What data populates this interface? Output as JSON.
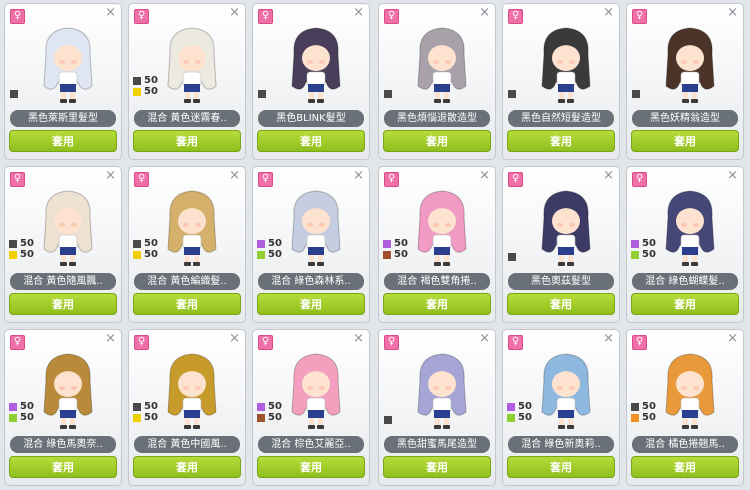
{
  "icons": {
    "gender": "♀",
    "close": "×"
  },
  "apply_label": "套用",
  "cards": [
    {
      "name": "黑色萊斯里髮型",
      "stats": [],
      "hair": "#dfe6f2",
      "marker": true
    },
    {
      "name": "混合 黃色迷霧春..",
      "stats": [
        {
          "color": "#4a4a4a",
          "value": "50"
        },
        {
          "color": "#f0d000",
          "value": "50"
        }
      ],
      "hair": "#ece9e0",
      "marker": false
    },
    {
      "name": "黑色BLINK髮型",
      "stats": [],
      "hair": "#4a3f5a",
      "marker": true
    },
    {
      "name": "黑色煩惱退散造型",
      "stats": [],
      "hair": "#a8a1a9",
      "marker": true
    },
    {
      "name": "黑色自然短髮造型",
      "stats": [],
      "hair": "#3a3a3a",
      "marker": true
    },
    {
      "name": "黑色妖精翁造型",
      "stats": [],
      "hair": "#4b3327",
      "marker": true
    },
    {
      "name": "混合 黃色隨風飄..",
      "stats": [
        {
          "color": "#4a4a4a",
          "value": "50"
        },
        {
          "color": "#f0d000",
          "value": "50"
        }
      ],
      "hair": "#ede2d2",
      "marker": false
    },
    {
      "name": "混合 黃色編織髮..",
      "stats": [
        {
          "color": "#4a4a4a",
          "value": "50"
        },
        {
          "color": "#f0d000",
          "value": "50"
        }
      ],
      "hair": "#d4b06a",
      "marker": false
    },
    {
      "name": "混合 綠色森林系..",
      "stats": [
        {
          "color": "#b05de0",
          "value": "50"
        },
        {
          "color": "#8fd030",
          "value": "50"
        }
      ],
      "hair": "#c6cde0",
      "marker": false
    },
    {
      "name": "混合 褐色雙角捲..",
      "stats": [
        {
          "color": "#b05de0",
          "value": "50"
        },
        {
          "color": "#a0522d",
          "value": "50"
        }
      ],
      "hair": "#f09ac4",
      "marker": false
    },
    {
      "name": "黑色奧茲髮型",
      "stats": [],
      "hair": "#3d3a66",
      "marker": true
    },
    {
      "name": "混合 綠色蝴蝶髮..",
      "stats": [
        {
          "color": "#b05de0",
          "value": "50"
        },
        {
          "color": "#8fd030",
          "value": "50"
        }
      ],
      "hair": "#454876",
      "marker": false
    },
    {
      "name": "混合 綠色馬奧奈..",
      "stats": [
        {
          "color": "#b05de0",
          "value": "50"
        },
        {
          "color": "#8fd030",
          "value": "50"
        }
      ],
      "hair": "#b88a3a",
      "marker": false
    },
    {
      "name": "混合 黃色中國風..",
      "stats": [
        {
          "color": "#4a4a4a",
          "value": "50"
        },
        {
          "color": "#f0d000",
          "value": "50"
        }
      ],
      "hair": "#c69b2a",
      "marker": false
    },
    {
      "name": "混合 棕色艾麗亞..",
      "stats": [
        {
          "color": "#b05de0",
          "value": "50"
        },
        {
          "color": "#a0522d",
          "value": "50"
        }
      ],
      "hair": "#f2a0bd",
      "marker": false
    },
    {
      "name": "黑色甜蜜馬尾造型",
      "stats": [],
      "hair": "#a7a5d6",
      "marker": true
    },
    {
      "name": "混合 綠色新奧莉..",
      "stats": [
        {
          "color": "#b05de0",
          "value": "50"
        },
        {
          "color": "#8fd030",
          "value": "50"
        }
      ],
      "hair": "#8fb8e0",
      "marker": false
    },
    {
      "name": "混合 橘色捲翹馬..",
      "stats": [
        {
          "color": "#4a4a4a",
          "value": "50"
        },
        {
          "color": "#f09020",
          "value": "50"
        }
      ],
      "hair": "#e89a3a",
      "marker": false
    }
  ]
}
